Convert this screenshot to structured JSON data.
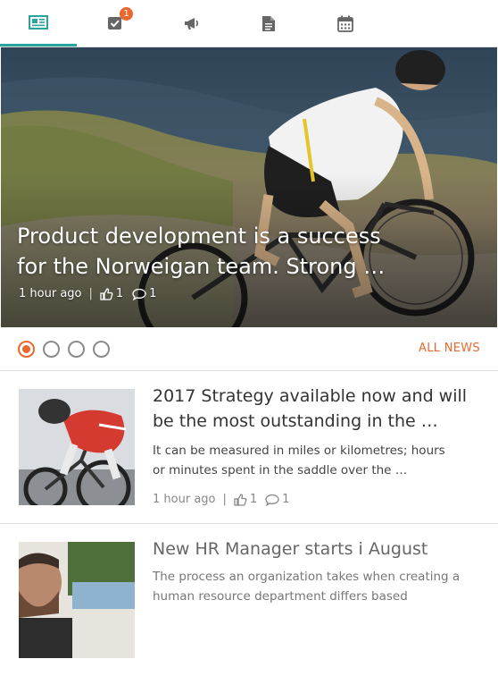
{
  "tabs": [
    {
      "name": "news",
      "icon": "newspaper-icon",
      "active": true
    },
    {
      "name": "tasks",
      "icon": "checkbox-icon",
      "badge": "1"
    },
    {
      "name": "announcements",
      "icon": "megaphone-icon"
    },
    {
      "name": "documents",
      "icon": "document-icon"
    },
    {
      "name": "events",
      "icon": "calendar-icon"
    }
  ],
  "hero": {
    "title": "Product development is a success for the Norweigan team. Strong …",
    "time": "1 hour ago",
    "likes": "1",
    "comments": "1"
  },
  "pager": {
    "dots": 4,
    "active_index": 0,
    "all_news_label": "ALL NEWS"
  },
  "news": [
    {
      "title": "2017 Strategy available now and will be the most outstanding in the …",
      "excerpt": "It can be measured in miles or kilometres; hours or minutes spent in the saddle over the …",
      "time": "1 hour ago",
      "likes": "1",
      "comments": "1"
    },
    {
      "title": "New HR Manager starts i August",
      "excerpt": "The process an organization takes when creating a human resource department differs based"
    }
  ],
  "colors": {
    "accent": "#e9682f",
    "active_tab_underline": "#2aa39b"
  }
}
